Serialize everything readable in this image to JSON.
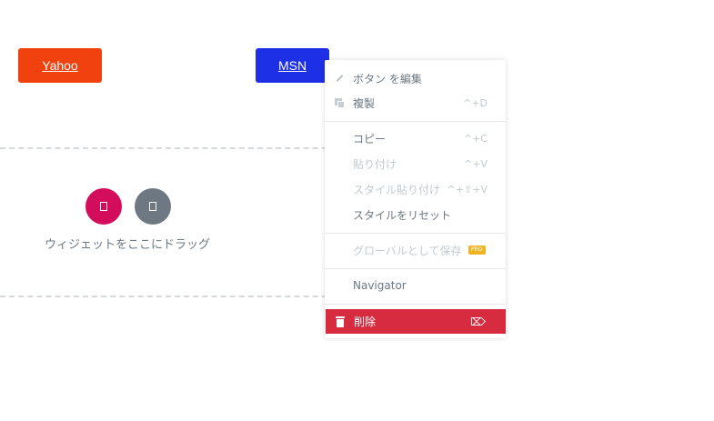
{
  "colors": {
    "yahoo_button": "#f0410f",
    "msn_button": "#1e30e6",
    "add_circle": "#d30c5c",
    "template_circle": "#6d7882",
    "delete_item": "#d72b3f",
    "pro_badge": "#f0b323"
  },
  "buttons": {
    "yahoo": "Yahoo",
    "msn": "MSN"
  },
  "dropzone": {
    "add_icon": "plus-square-icon",
    "template_icon": "folder-icon",
    "text": "ウィジェットをここにドラッグ"
  },
  "context_menu": {
    "edit": {
      "label": "ボタン を編集",
      "icon": "pencil-icon"
    },
    "duplicate": {
      "label": "複製",
      "shortcut": "^+D",
      "icon": "copy-icon"
    },
    "copy": {
      "label": "コピー",
      "shortcut": "^+C"
    },
    "paste": {
      "label": "貼り付け",
      "shortcut": "^+V"
    },
    "paste_style": {
      "label": "スタイル貼り付け",
      "shortcut": "^+⇧+V"
    },
    "reset_style": {
      "label": "スタイルをリセット"
    },
    "save_global": {
      "label": "グローバルとして保存",
      "badge": "PRO"
    },
    "navigator": {
      "label": "Navigator"
    },
    "delete": {
      "label": "削除",
      "icon": "trash-icon",
      "shortcut_icon": "backspace-icon"
    }
  }
}
